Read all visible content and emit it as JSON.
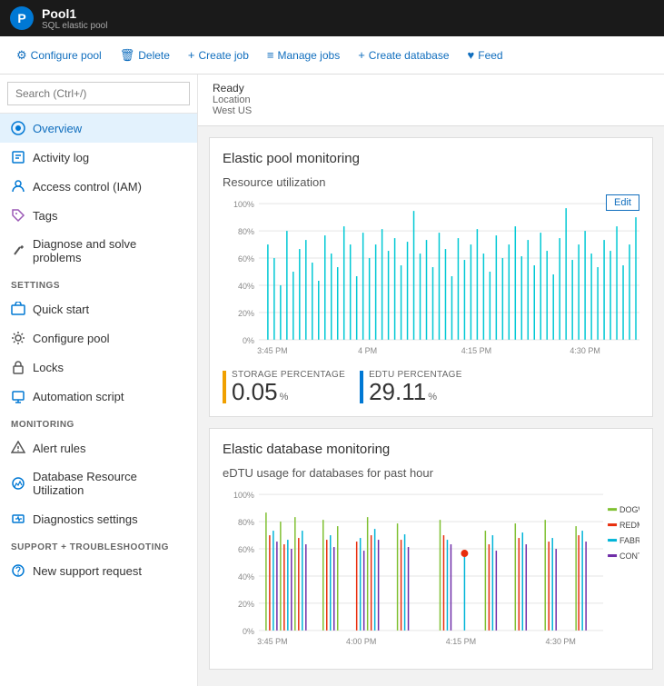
{
  "topbar": {
    "title": "Pool1",
    "subtitle": "SQL elastic pool",
    "logo_text": "P"
  },
  "toolbar": {
    "buttons": [
      {
        "label": "Configure pool",
        "icon": "⚙"
      },
      {
        "label": "Delete",
        "icon": "🗑"
      },
      {
        "label": "Create job",
        "icon": "+"
      },
      {
        "label": "Manage jobs",
        "icon": "≡"
      },
      {
        "label": "Create database",
        "icon": "+"
      },
      {
        "label": "Feed",
        "icon": "♥"
      }
    ]
  },
  "sidebar": {
    "search_placeholder": "Search (Ctrl+/)",
    "items": [
      {
        "label": "Overview",
        "icon": "overview",
        "active": true,
        "section": null
      },
      {
        "label": "Activity log",
        "icon": "activity",
        "active": false,
        "section": null
      },
      {
        "label": "Access control (IAM)",
        "icon": "iam",
        "active": false,
        "section": null
      },
      {
        "label": "Tags",
        "icon": "tag",
        "active": false,
        "section": null
      },
      {
        "label": "Diagnose and solve problems",
        "icon": "diagnose",
        "active": false,
        "section": null
      },
      {
        "label": "SETTINGS",
        "type": "header"
      },
      {
        "label": "Quick start",
        "icon": "quickstart",
        "active": false,
        "section": "SETTINGS"
      },
      {
        "label": "Configure pool",
        "icon": "configure",
        "active": false,
        "section": "SETTINGS"
      },
      {
        "label": "Locks",
        "icon": "lock",
        "active": false,
        "section": "SETTINGS"
      },
      {
        "label": "Automation script",
        "icon": "automation",
        "active": false,
        "section": "SETTINGS"
      },
      {
        "label": "MONITORING",
        "type": "header"
      },
      {
        "label": "Alert rules",
        "icon": "alert",
        "active": false,
        "section": "MONITORING"
      },
      {
        "label": "Database Resource Utilization",
        "icon": "dbresource",
        "active": false,
        "section": "MONITORING"
      },
      {
        "label": "Diagnostics settings",
        "icon": "diagnostics",
        "active": false,
        "section": "MONITORING"
      },
      {
        "label": "SUPPORT + TROUBLESHOOTING",
        "type": "header"
      },
      {
        "label": "New support request",
        "icon": "support",
        "active": false,
        "section": "SUPPORT + TROUBLESHOOTING"
      }
    ]
  },
  "content": {
    "status": "Ready",
    "location_label": "Location",
    "location_value": "West US",
    "section1_title": "Elastic pool monitoring",
    "chart1_title": "Resource utilization",
    "edit_label": "Edit",
    "chart1_y_labels": [
      "100%",
      "80%",
      "60%",
      "40%",
      "20%",
      "0%"
    ],
    "chart1_x_labels": [
      "3:45 PM",
      "4 PM",
      "4:15 PM",
      "4:30 PM"
    ],
    "metric1_label": "STORAGE PERCENTAGE",
    "metric1_value": "0.05",
    "metric1_unit": "%",
    "metric2_label": "EDTU PERCENTAGE",
    "metric2_value": "29.11",
    "metric2_unit": "%",
    "section2_title": "Elastic database monitoring",
    "chart2_title": "eDTU usage for databases for past hour",
    "chart2_y_labels": [
      "100%",
      "80%",
      "60%",
      "40%",
      "20%",
      "0%"
    ],
    "chart2_x_labels": [
      "3:45 PM",
      "4:00 PM",
      "4:15 PM",
      "4:30 PM"
    ],
    "legend": [
      {
        "label": "DOGWOOD...",
        "color": "#7fc031"
      },
      {
        "label": "REDMAPLER...",
        "color": "#e82d0c"
      },
      {
        "label": "FABRIKAMJA...",
        "color": "#00b4d8"
      },
      {
        "label": "CONTOSO...",
        "color": "#6f2da8"
      }
    ]
  }
}
